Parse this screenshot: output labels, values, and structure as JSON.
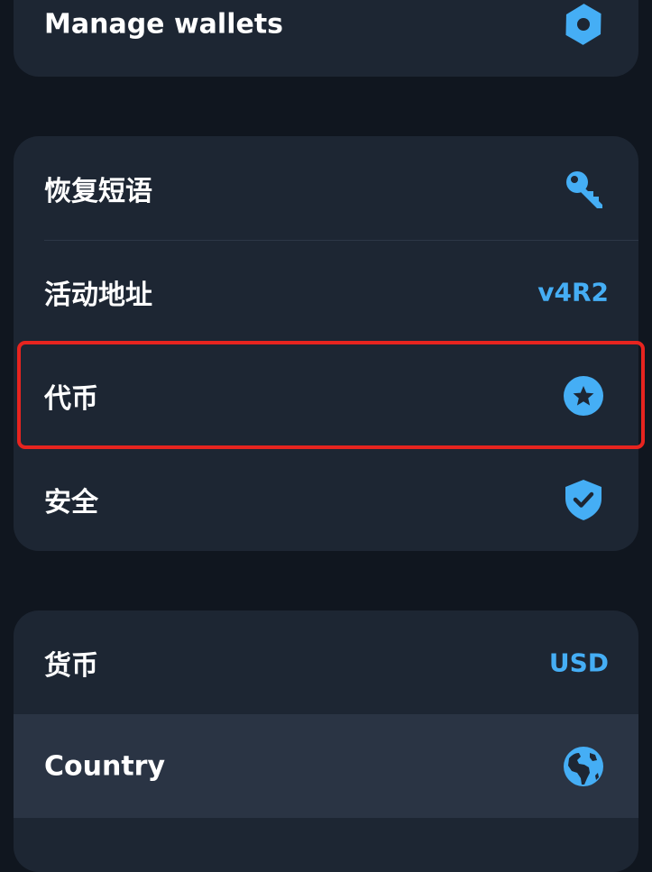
{
  "colors": {
    "background": "#10161f",
    "card": "#1d2633",
    "accent": "#45aef5",
    "highlight_border": "#e7241f"
  },
  "wallet_group": {
    "manage_wallets": {
      "label": "Manage wallets",
      "icon": "gear-icon"
    }
  },
  "wallet_settings": {
    "recovery_phrase": {
      "label": "恢复短语",
      "icon": "key-icon"
    },
    "active_address": {
      "label": "活动地址",
      "value": "v4R2"
    },
    "tokens": {
      "label": "代币",
      "icon": "star-icon"
    },
    "security": {
      "label": "安全",
      "icon": "shield-check-icon"
    }
  },
  "app_settings": {
    "currency": {
      "label": "货币",
      "value": "USD"
    },
    "country": {
      "label": "Country",
      "icon": "globe-icon"
    }
  }
}
